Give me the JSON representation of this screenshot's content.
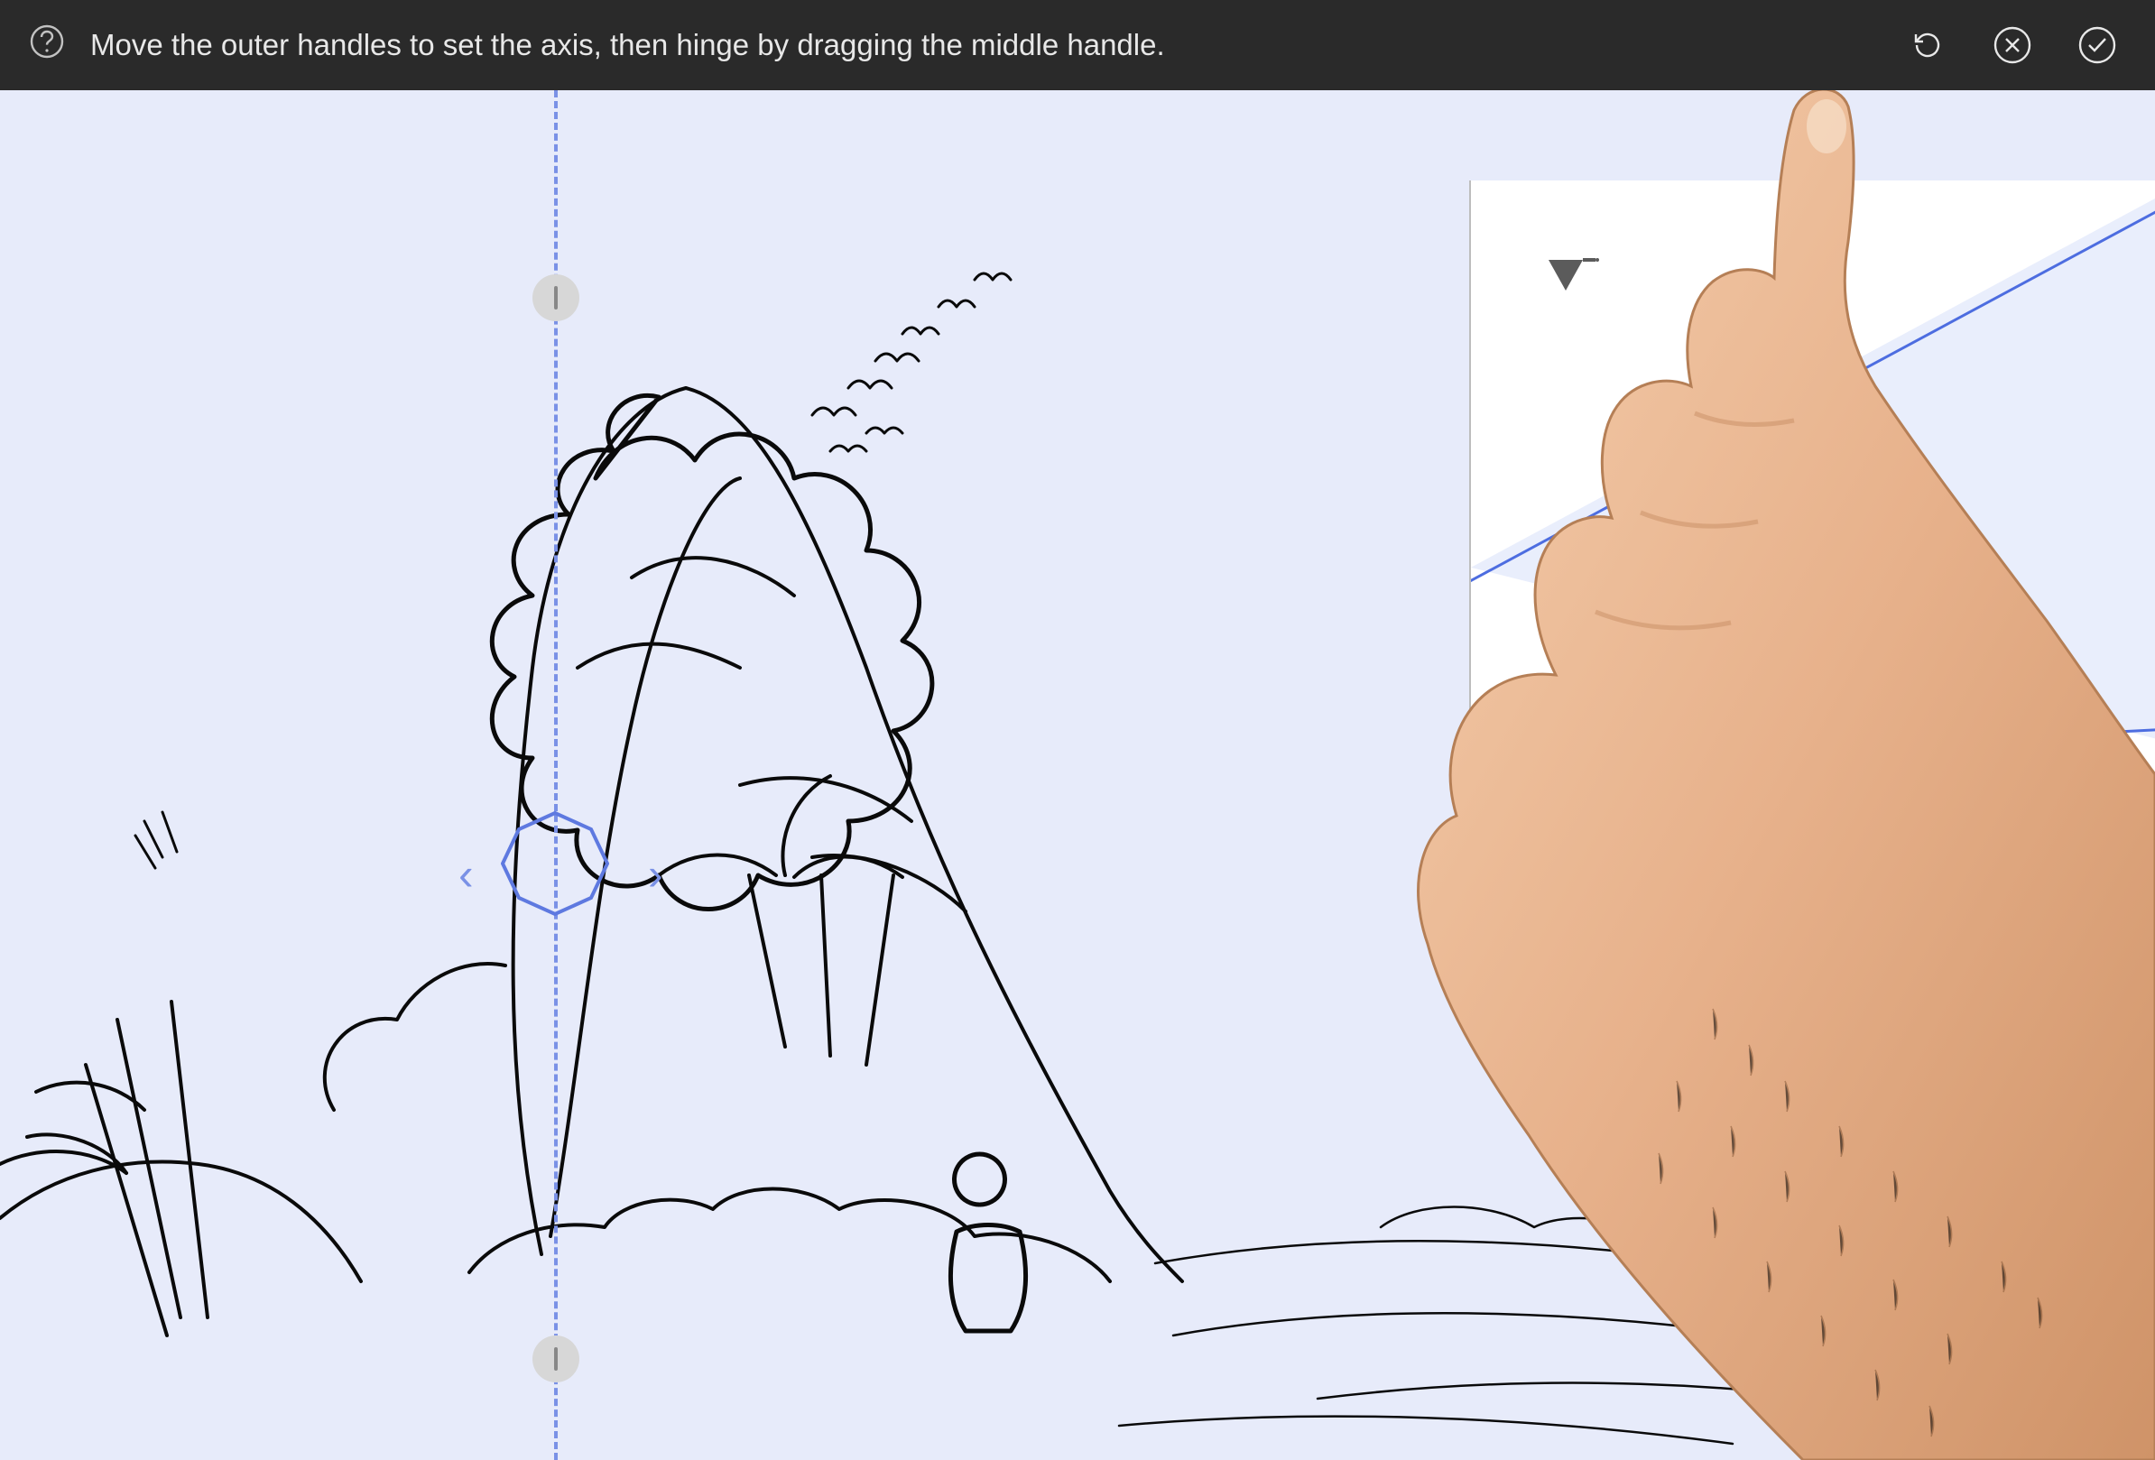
{
  "topbar": {
    "hint": "Move the outer handles to set the axis, then hinge by dragging the middle handle.",
    "help_icon": "help-icon",
    "reset_icon": "reset-icon",
    "cancel_icon": "cancel-icon",
    "confirm_icon": "confirm-icon"
  },
  "axis": {
    "top_handle": "axis-top-handle",
    "mid_handle": "axis-middle-handle",
    "bottom_handle": "axis-bottom-handle",
    "left_arrow": "‹",
    "right_arrow": "›"
  },
  "preview": {
    "vanishing_icon": "vanishing-point-icon",
    "expand_icon": "expand-icon",
    "move_icon": "move-icon"
  },
  "colors": {
    "canvas_bg": "#e7ebfa",
    "guide_blue": "#7a91e6",
    "topbar_bg": "#2a2a2a"
  }
}
